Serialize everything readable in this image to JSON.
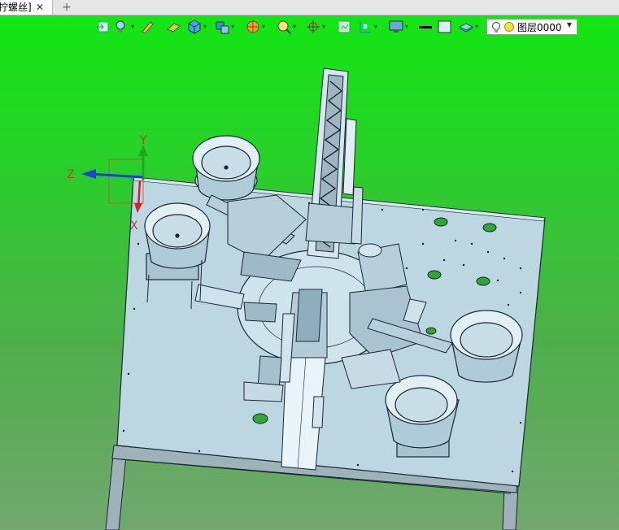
{
  "tab": {
    "title": "拧螺丝]",
    "close_label": "✕",
    "new_tab_label": "+"
  },
  "toolbar": {
    "items": [
      "view-icon",
      "light-icon",
      "pencil-icon",
      "eraser-icon",
      "cube-icon",
      "cube-stack-icon",
      "sphere-icon",
      "zoom-icon",
      "axis-icon",
      "frame-icon",
      "align-icon",
      "monitor-icon",
      "line-style-icon",
      "fill-color-icon",
      "layers-icon"
    ],
    "layer_select": {
      "value": "图层0000"
    }
  },
  "axes": {
    "y": "Y",
    "z": "Z",
    "x": "X"
  },
  "colors": {
    "background_top": "#11e811",
    "background_bottom": "#72a770",
    "plate": "#bcd7e2",
    "edge": "#1a2633"
  }
}
